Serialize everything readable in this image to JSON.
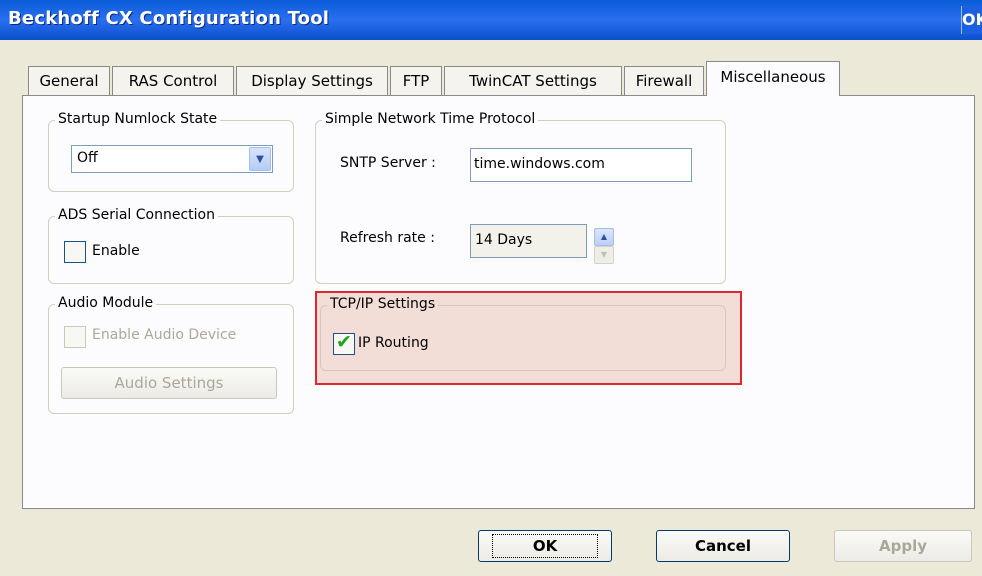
{
  "window": {
    "title": "Beckhoff CX Configuration Tool",
    "title_ok": "OK"
  },
  "tabs": [
    {
      "label": "General"
    },
    {
      "label": "RAS Control"
    },
    {
      "label": "Display Settings"
    },
    {
      "label": "FTP"
    },
    {
      "label": "TwinCAT Settings"
    },
    {
      "label": "Firewall"
    },
    {
      "label": "Miscellaneous",
      "active": true
    }
  ],
  "numlock": {
    "legend": "Startup Numlock State",
    "value": "Off"
  },
  "ads": {
    "legend": "ADS Serial Connection",
    "enable_label": "Enable",
    "checked": false
  },
  "audio": {
    "legend": "Audio Module",
    "enable_label": "Enable Audio Device",
    "settings_button": "Audio Settings",
    "enabled": false
  },
  "sntp": {
    "legend": "Simple Network Time Protocol",
    "server_label": "SNTP Server :",
    "server_value": "time.windows.com",
    "refresh_label": "Refresh rate :",
    "refresh_value": "14 Days"
  },
  "tcpip": {
    "legend": "TCP/IP Settings",
    "routing_label": "IP Routing",
    "routing_checked": true,
    "highlight_color": "#e0262f"
  },
  "footer": {
    "ok": "OK",
    "cancel": "Cancel",
    "apply": "Apply"
  }
}
